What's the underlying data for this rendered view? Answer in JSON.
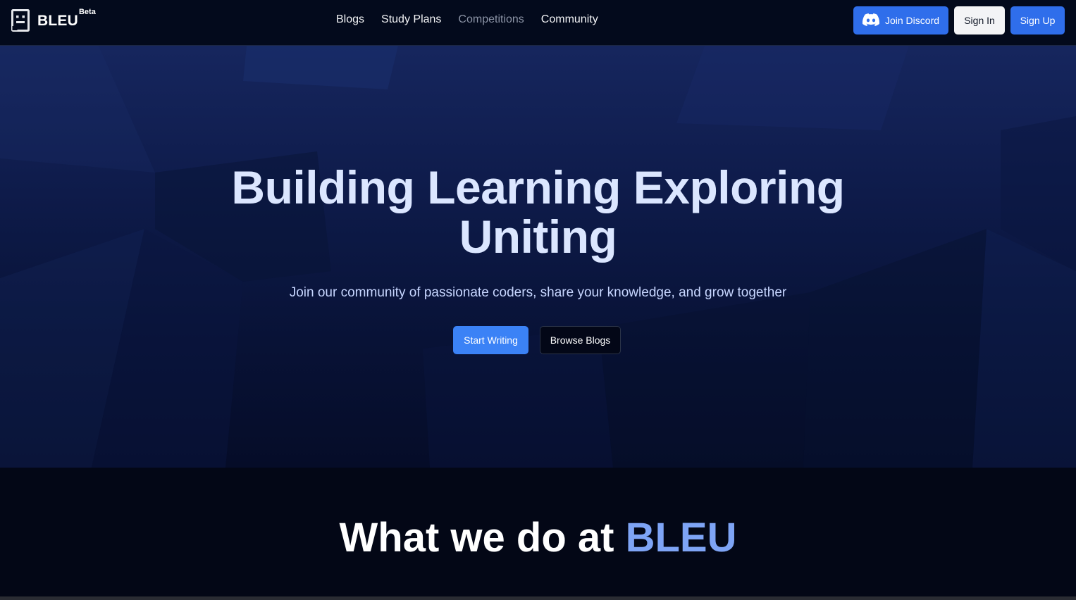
{
  "brand": {
    "name": "BLEU",
    "badge": "Beta"
  },
  "nav": {
    "links": [
      {
        "label": "Blogs",
        "muted": false
      },
      {
        "label": "Study Plans",
        "muted": false
      },
      {
        "label": "Competitions",
        "muted": true
      },
      {
        "label": "Community",
        "muted": false
      }
    ]
  },
  "actions": {
    "discord": "Join Discord",
    "signin": "Sign In",
    "signup": "Sign Up"
  },
  "hero": {
    "title_line1": "Building Learning Exploring",
    "title_line2": "Uniting",
    "subtitle": "Join our community of passionate coders, share your knowledge, and grow together",
    "start_button": "Start Writing",
    "browse_button": "Browse Blogs"
  },
  "section": {
    "title_prefix": "What we do at",
    "title_accent": "BLEU"
  },
  "colors": {
    "primary": "#2f6eeb",
    "accent": "#7ea4f5",
    "navbar_bg": "#030a1c",
    "hero_title": "#dbe6ff"
  },
  "icons": {
    "logo": "bleu-logo-icon",
    "discord": "discord-icon"
  }
}
